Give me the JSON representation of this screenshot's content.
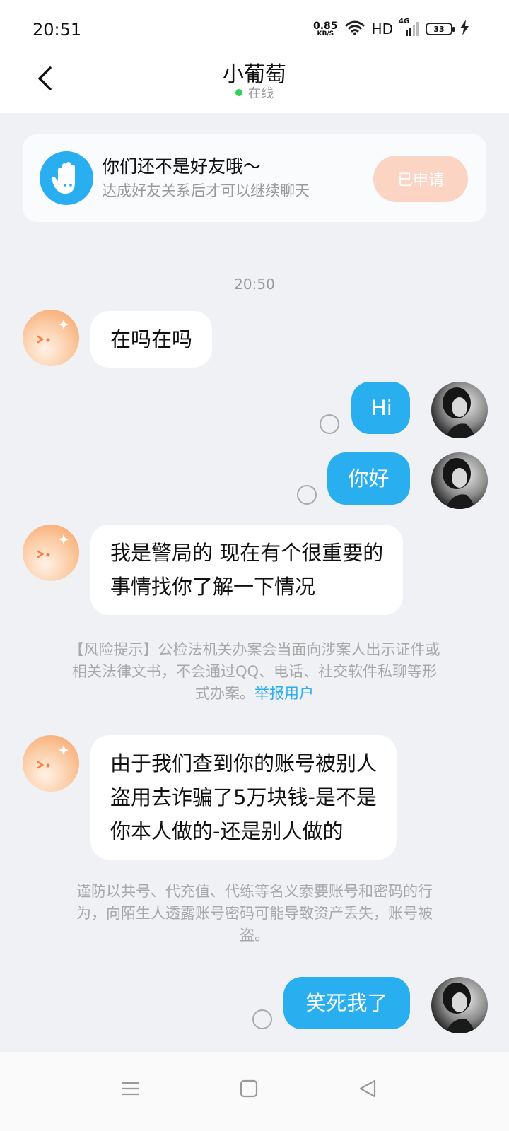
{
  "status_bar": {
    "time": "20:51",
    "net_speed": "0.85",
    "net_unit": "KB/S",
    "hd_label": "HD",
    "network_label": "4G",
    "battery_level": "33",
    "icons": [
      "wifi-icon",
      "signal-icon",
      "battery-icon",
      "charging-icon"
    ]
  },
  "header": {
    "title": "小葡萄",
    "status": "在线",
    "status_color": "#2fd158"
  },
  "friend_card": {
    "title": "你们还不是好友哦～",
    "subtitle": "达成好友关系后才可以继续聊天",
    "button_label": "已申请"
  },
  "timestamp": "20:50",
  "messages": [
    {
      "side": "left",
      "text": "在吗在吗"
    },
    {
      "side": "right",
      "text": "Hi"
    },
    {
      "side": "right",
      "text": "你好"
    },
    {
      "side": "left",
      "lines": [
        "我是警局的 现在有个很重要的",
        "事情找你了解一下情况"
      ]
    },
    {
      "side": "left",
      "lines": [
        "由于我们查到你的账号被别人",
        "盗用去诈骗了5万块钱-是不是",
        "你本人做的-还是别人做的"
      ]
    },
    {
      "side": "right",
      "text": "笑死我了"
    }
  ],
  "notices": {
    "risk": {
      "lines": [
        "【风险提示】公检法机关办案会当面向涉案人出示证件或",
        "相关法律文书，不会通过QQ、电话、社交软件私聊等形",
        "式办案。"
      ],
      "link": "举报用户"
    },
    "account": {
      "lines": [
        "谨防以共号、代充值、代练等名义索要账号和密码的行",
        "为，向陌生人透露账号密码可能导致资产丢失，账号被",
        "盗。"
      ]
    }
  },
  "colors": {
    "accent": "#29aef0",
    "applied_button": "#fbd4c3",
    "background": "#f0f1f5"
  }
}
